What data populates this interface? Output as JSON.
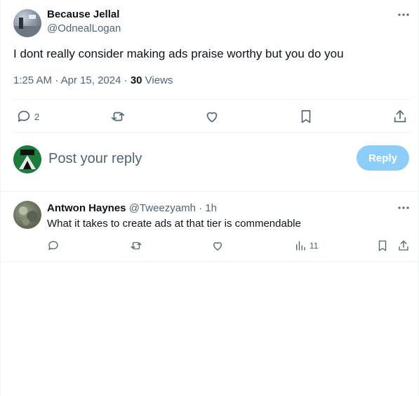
{
  "main_tweet": {
    "author_name": "Because Jellal",
    "author_handle": "@OdnealLogan",
    "text": "I dont really consider making ads praise worthy but you do you",
    "time": "1:25 AM",
    "separator": "·",
    "date": "Apr 15, 2024",
    "views_count": "30",
    "views_label": "Views",
    "reply_count": "2"
  },
  "composer": {
    "placeholder": "Post your reply",
    "reply_button": "Reply"
  },
  "reply": {
    "author_name": "Antwon Haynes",
    "author_handle": "@Tweezyamh",
    "separator": "·",
    "age": "1h",
    "text": "What it takes to create ads at that tier is commendable",
    "views_count": "11"
  },
  "colors": {
    "accent_disabled": "#8ecdf8",
    "secondary_text": "#536471",
    "border": "#eff3f4"
  }
}
